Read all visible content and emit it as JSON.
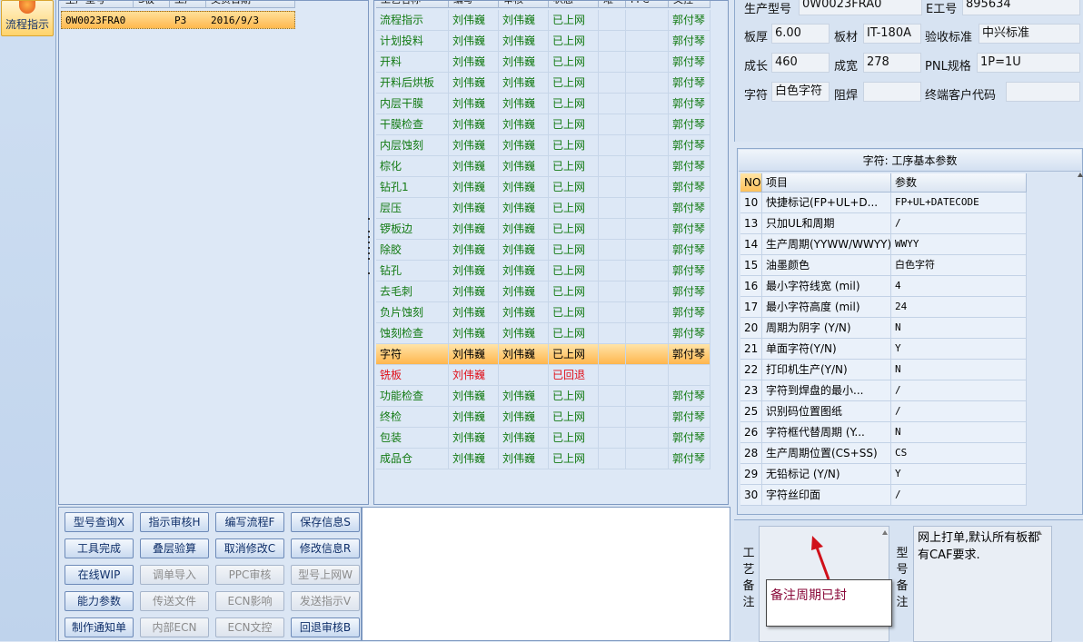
{
  "left_toolbar": {
    "flow_button_label": "流程指示",
    "flow_icon": "flame-icon"
  },
  "product_list": {
    "columns": [
      "生产型号",
      "S板",
      "工厂",
      "交货日期"
    ],
    "rows": [
      {
        "model": "0W0023FRA0",
        "s_board": "",
        "plant": "P3",
        "delivery_date": "2016/9/3"
      }
    ]
  },
  "process_grid": {
    "columns": [
      "工艺名称",
      "编写",
      "审核",
      "状态",
      "难",
      "FPC",
      "文控"
    ],
    "rows": [
      {
        "name": "流程指示",
        "writer": "刘伟巍",
        "reviewer": "刘伟巍",
        "status": "已上网",
        "doc": "郭付琴"
      },
      {
        "name": "计划投料",
        "writer": "刘伟巍",
        "reviewer": "刘伟巍",
        "status": "已上网",
        "doc": "郭付琴"
      },
      {
        "name": "开料",
        "writer": "刘伟巍",
        "reviewer": "刘伟巍",
        "status": "已上网",
        "doc": "郭付琴"
      },
      {
        "name": "开料后烘板",
        "writer": "刘伟巍",
        "reviewer": "刘伟巍",
        "status": "已上网",
        "doc": "郭付琴"
      },
      {
        "name": "内层干膜",
        "writer": "刘伟巍",
        "reviewer": "刘伟巍",
        "status": "已上网",
        "doc": "郭付琴"
      },
      {
        "name": "干膜检查",
        "writer": "刘伟巍",
        "reviewer": "刘伟巍",
        "status": "已上网",
        "doc": "郭付琴"
      },
      {
        "name": "内层蚀刻",
        "writer": "刘伟巍",
        "reviewer": "刘伟巍",
        "status": "已上网",
        "doc": "郭付琴"
      },
      {
        "name": "棕化",
        "writer": "刘伟巍",
        "reviewer": "刘伟巍",
        "status": "已上网",
        "doc": "郭付琴"
      },
      {
        "name": "钻孔1",
        "writer": "刘伟巍",
        "reviewer": "刘伟巍",
        "status": "已上网",
        "doc": "郭付琴"
      },
      {
        "name": "层压",
        "writer": "刘伟巍",
        "reviewer": "刘伟巍",
        "status": "已上网",
        "doc": "郭付琴"
      },
      {
        "name": "锣板边",
        "writer": "刘伟巍",
        "reviewer": "刘伟巍",
        "status": "已上网",
        "doc": "郭付琴"
      },
      {
        "name": "除胶",
        "writer": "刘伟巍",
        "reviewer": "刘伟巍",
        "status": "已上网",
        "doc": "郭付琴"
      },
      {
        "name": "钻孔",
        "writer": "刘伟巍",
        "reviewer": "刘伟巍",
        "status": "已上网",
        "doc": "郭付琴"
      },
      {
        "name": "去毛刺",
        "writer": "刘伟巍",
        "reviewer": "刘伟巍",
        "status": "已上网",
        "doc": "郭付琴"
      },
      {
        "name": "负片蚀刻",
        "writer": "刘伟巍",
        "reviewer": "刘伟巍",
        "status": "已上网",
        "doc": "郭付琴"
      },
      {
        "name": "蚀刻检查",
        "writer": "刘伟巍",
        "reviewer": "刘伟巍",
        "status": "已上网",
        "doc": "郭付琴"
      },
      {
        "name": "字符",
        "writer": "刘伟巍",
        "reviewer": "刘伟巍",
        "status": "已上网",
        "doc": "郭付琴"
      },
      {
        "name": "铣板",
        "writer": "刘伟巍",
        "reviewer": "",
        "status": "已回退",
        "doc": ""
      },
      {
        "name": "功能检查",
        "writer": "刘伟巍",
        "reviewer": "刘伟巍",
        "status": "已上网",
        "doc": "郭付琴"
      },
      {
        "name": "终检",
        "writer": "刘伟巍",
        "reviewer": "刘伟巍",
        "status": "已上网",
        "doc": "郭付琴"
      },
      {
        "name": "包装",
        "writer": "刘伟巍",
        "reviewer": "刘伟巍",
        "status": "已上网",
        "doc": "郭付琴"
      },
      {
        "name": "成品仓",
        "writer": "刘伟巍",
        "reviewer": "刘伟巍",
        "status": "已上网",
        "doc": "郭付琴"
      }
    ],
    "selected_row": "字符",
    "returned_row": "铣板"
  },
  "info": {
    "model_label": "生产型号",
    "model_value": "0W0023FRA0",
    "eno_label": "E工号",
    "eno_value": "895634",
    "thickness_label": "板厚",
    "thickness_value": "6.00",
    "material_label": "板材",
    "material_value": "IT-180A",
    "standard_label": "验收标准",
    "standard_value": "中兴标准",
    "length_label": "成长",
    "length_value": "460",
    "width_label": "成宽",
    "width_value": "278",
    "pnl_label": "PNL规格",
    "pnl_value": "1P=1U",
    "char_label": "字符",
    "char_value": "白色字符",
    "solder_label": "阻焊",
    "solder_value": "",
    "customer_label": "终端客户代码",
    "customer_value": ""
  },
  "params": {
    "title": "字符: 工序基本参数",
    "columns": [
      "NO",
      "项目",
      "参数"
    ],
    "rows": [
      {
        "no": "10",
        "item": "快捷标记(FP+UL+D...",
        "value": "FP+UL+DATECODE"
      },
      {
        "no": "13",
        "item": "只加UL和周期",
        "value": "/"
      },
      {
        "no": "14",
        "item": "生产周期(YYWW/WWYY)",
        "value": "WWYY"
      },
      {
        "no": "15",
        "item": "油墨颜色",
        "value": "白色字符"
      },
      {
        "no": "16",
        "item": "最小字符线宽 (mil)",
        "value": "4"
      },
      {
        "no": "17",
        "item": "最小字符高度 (mil)",
        "value": "24"
      },
      {
        "no": "20",
        "item": "周期为阴字 (Y/N)",
        "value": "N"
      },
      {
        "no": "21",
        "item": "单面字符(Y/N)",
        "value": "Y"
      },
      {
        "no": "22",
        "item": "打印机生产(Y/N)",
        "value": "N"
      },
      {
        "no": "23",
        "item": "字符到焊盘的最小...",
        "value": "/"
      },
      {
        "no": "25",
        "item": "识别码位置图纸",
        "value": "/"
      },
      {
        "no": "26",
        "item": "字符框代替周期 (Y...",
        "value": "N"
      },
      {
        "no": "28",
        "item": "生产周期位置(CS+SS)",
        "value": "CS"
      },
      {
        "no": "29",
        "item": "无铅标记 (Y/N)",
        "value": "Y"
      },
      {
        "no": "30",
        "item": "字符丝印面",
        "value": "/"
      }
    ]
  },
  "buttons": [
    {
      "label": "型号查询X",
      "enabled": true
    },
    {
      "label": "指示审核H",
      "enabled": true
    },
    {
      "label": "编写流程F",
      "enabled": true
    },
    {
      "label": "保存信息S",
      "enabled": true
    },
    {
      "label": "工具完成",
      "enabled": true
    },
    {
      "label": "叠层验算",
      "enabled": true
    },
    {
      "label": "取消修改C",
      "enabled": true
    },
    {
      "label": "修改信息R",
      "enabled": true
    },
    {
      "label": "在线WIP",
      "enabled": true
    },
    {
      "label": "调单导入",
      "enabled": false
    },
    {
      "label": "PPC审核",
      "enabled": false
    },
    {
      "label": "型号上网W",
      "enabled": false
    },
    {
      "label": "能力参数",
      "enabled": true
    },
    {
      "label": "传送文件",
      "enabled": false
    },
    {
      "label": "ECN影响",
      "enabled": false
    },
    {
      "label": "发送指示V",
      "enabled": false
    },
    {
      "label": "制作通知单",
      "enabled": true
    },
    {
      "label": "内部ECN",
      "enabled": false
    },
    {
      "label": "ECN文控",
      "enabled": false
    },
    {
      "label": "回退审核B",
      "enabled": true
    }
  ],
  "remarks": {
    "process_remark_label": "工艺备注",
    "process_remark_text": "",
    "model_remark_label": "型号备注",
    "model_remark_text": "网上打单,默认所有板都有CAF要求.",
    "callout_text": "备注周期已封"
  },
  "colors": {
    "green_text": "#127a12",
    "red_text": "#e0101a",
    "selection": "#ffb44a"
  }
}
